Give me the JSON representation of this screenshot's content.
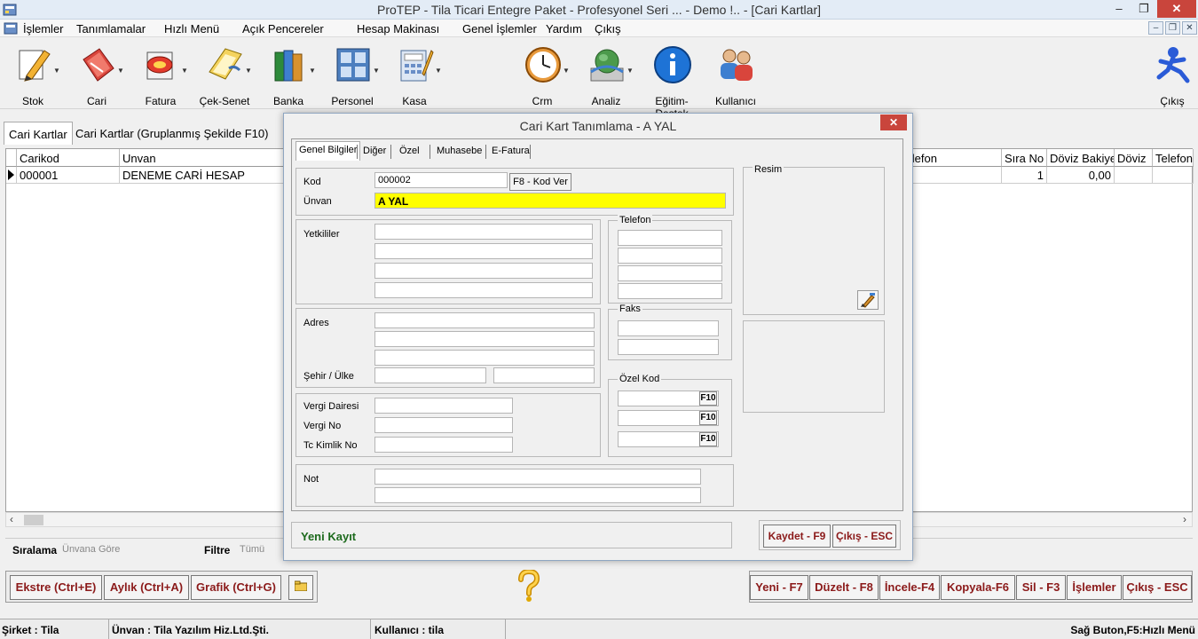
{
  "window": {
    "title": "ProTEP - Tila Ticari Entegre Paket - Profesyonel Seri ... - Demo !.. - [Cari Kartlar]",
    "minimize": "–",
    "maximize": "❐",
    "close": "✕"
  },
  "menu": {
    "items": [
      "İşlemler",
      "Tanımlamalar",
      "Hızlı Menü",
      "Açık Pencereler",
      "Hesap Makinası",
      "Genel İşlemler",
      "Yardım",
      "Çıkış"
    ],
    "mdi_min": "–",
    "mdi_restore": "❐",
    "mdi_close": "✕"
  },
  "toolbar": {
    "items": [
      {
        "label": "Stok",
        "icon": "pencil-icon"
      },
      {
        "label": "Cari",
        "icon": "book-icon"
      },
      {
        "label": "Fatura",
        "icon": "invoice-icon"
      },
      {
        "label": "Çek-Senet",
        "icon": "cheque-icon"
      },
      {
        "label": "Banka",
        "icon": "bank-books-icon"
      },
      {
        "label": "Personel",
        "icon": "personnel-icon"
      },
      {
        "label": "Kasa",
        "icon": "calculator-icon"
      },
      {
        "label": "Crm",
        "icon": "clock-icon"
      },
      {
        "label": "Analiz",
        "icon": "globe-icon"
      },
      {
        "label": "Eğitim-Destek",
        "icon": "info-icon"
      },
      {
        "label": "Kullanıcı",
        "icon": "users-icon"
      },
      {
        "label": "Çıkış",
        "icon": "exit-runner-icon"
      }
    ]
  },
  "main_tabs": [
    "Cari Kartlar",
    "Cari Kartlar (Gruplanmış Şekilde F10)"
  ],
  "grid": {
    "headers": [
      "Carikod",
      "Unvan",
      "Telefon",
      "Sıra No",
      "Döviz Bakiye",
      "Döviz",
      "Telefon"
    ],
    "rows": [
      {
        "carikod": "000001",
        "unvan": "DENEME CARİ HESAP",
        "sira_no": "1",
        "doviz_bakiye": "0,00"
      }
    ]
  },
  "filter": {
    "siralama_label": "Sıralama",
    "siralama_value": "Ünvana Göre",
    "filtre_label": "Filtre",
    "filtre_value": "Tümü"
  },
  "bottom_left_buttons": [
    "Ekstre (Ctrl+E)",
    "Aylık (Ctrl+A)",
    "Grafik (Ctrl+G)"
  ],
  "bottom_right_buttons": [
    "Yeni - F7",
    "Düzelt - F8",
    "İncele-F4",
    "Kopyala-F6",
    "Sil - F3",
    "İşlemler",
    "Çıkış - ESC"
  ],
  "statusbar": {
    "sirket": "Şirket : Tila",
    "unvan": "Ünvan : Tila Yazılım Hiz.Ltd.Şti.",
    "kullanici": "Kullanıcı : tila",
    "hint": "Sağ Buton,F5:Hızlı Menü"
  },
  "dialog": {
    "title": "Cari Kart Tanımlama - A YAL",
    "close": "✕",
    "tabs": [
      "Genel Bilgiler",
      "Diğer",
      "Özel",
      "Muhasebe",
      "E-Fatura"
    ],
    "kod_label": "Kod",
    "kod_value": "000002",
    "kod_ver_button": "F8 - Kod Ver",
    "unvan_label": "Ünvan",
    "unvan_value": "A YAL",
    "yetkililer_label": "Yetkililer",
    "adres_label": "Adres",
    "sehir_ulke_label": "Şehir / Ülke",
    "vergi_dairesi_label": "Vergi Dairesi",
    "vergi_no_label": "Vergi No",
    "tc_kimlik_label": "Tc Kimlik No",
    "not_label": "Not",
    "telefon_title": "Telefon",
    "faks_title": "Faks",
    "ozel_kod_title": "Özel Kod",
    "f10": "F10",
    "resim_title": "Resim",
    "status": "Yeni Kayıt",
    "kaydet_button": "Kaydet - F9",
    "cikis_button": "Çıkış - ESC"
  },
  "help_icon": "question-icon"
}
